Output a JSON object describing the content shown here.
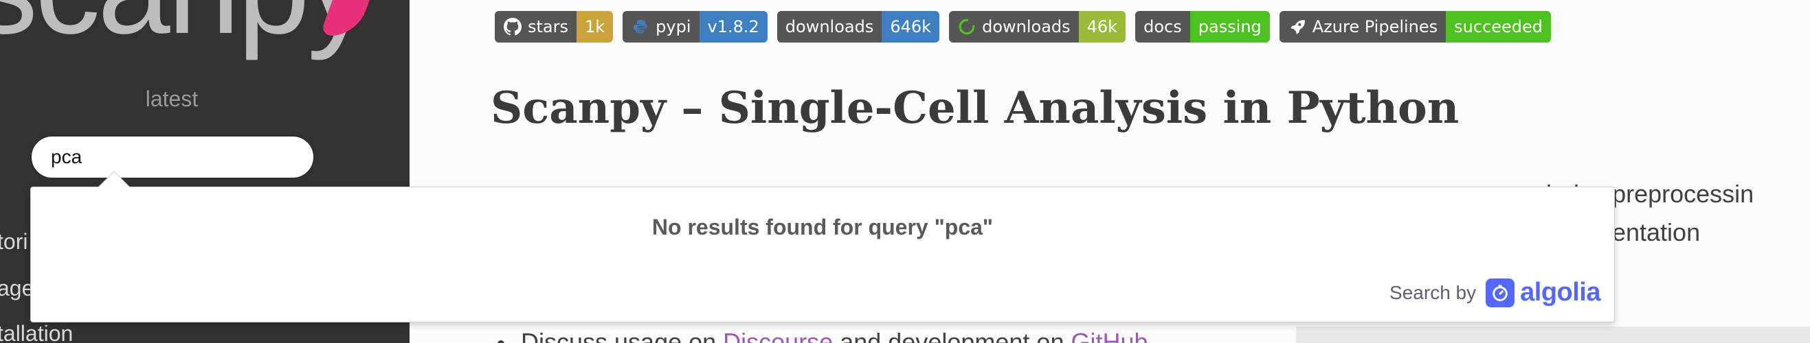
{
  "sidebar": {
    "logo": "scanpy",
    "version": "latest",
    "search": {
      "value": "pca"
    },
    "nav": [
      "tori",
      "age",
      "tallation"
    ]
  },
  "badges": [
    {
      "left": "stars",
      "right": "1k",
      "color": "#c9a43a",
      "icon": "github-icon"
    },
    {
      "left": "pypi",
      "right": "v1.8.2",
      "color": "#3e7fc1",
      "icon": "python-icon"
    },
    {
      "left": "downloads",
      "right": "646k",
      "color": "#3e7fc1",
      "icon": ""
    },
    {
      "left": "downloads",
      "right": "46k",
      "color": "#9aba3a",
      "icon": "conda-icon"
    },
    {
      "left": "docs",
      "right": "passing",
      "color": "#4dc21f",
      "icon": ""
    },
    {
      "left": "Azure Pipelines",
      "right": "succeeded",
      "color": "#4dc21f",
      "icon": "rocket-icon"
    }
  ],
  "main": {
    "title": "Scanpy – Single-Cell Analysis in Python",
    "body_right_1": "ludes preprocessin",
    "body_right_2": "mentation",
    "list": {
      "prefix": "Discuss usage on ",
      "link1": "Discourse",
      "middle": " and development on ",
      "link2": "GitHub"
    }
  },
  "dropdown": {
    "no_results": "No results found for query \"pca\"",
    "search_by": "Search by",
    "brand": "algolia"
  },
  "colors": {
    "sidebar_bg": "#343131",
    "accent": "#e8307a",
    "algolia": "#5468ff",
    "link": "#9b59b6"
  }
}
